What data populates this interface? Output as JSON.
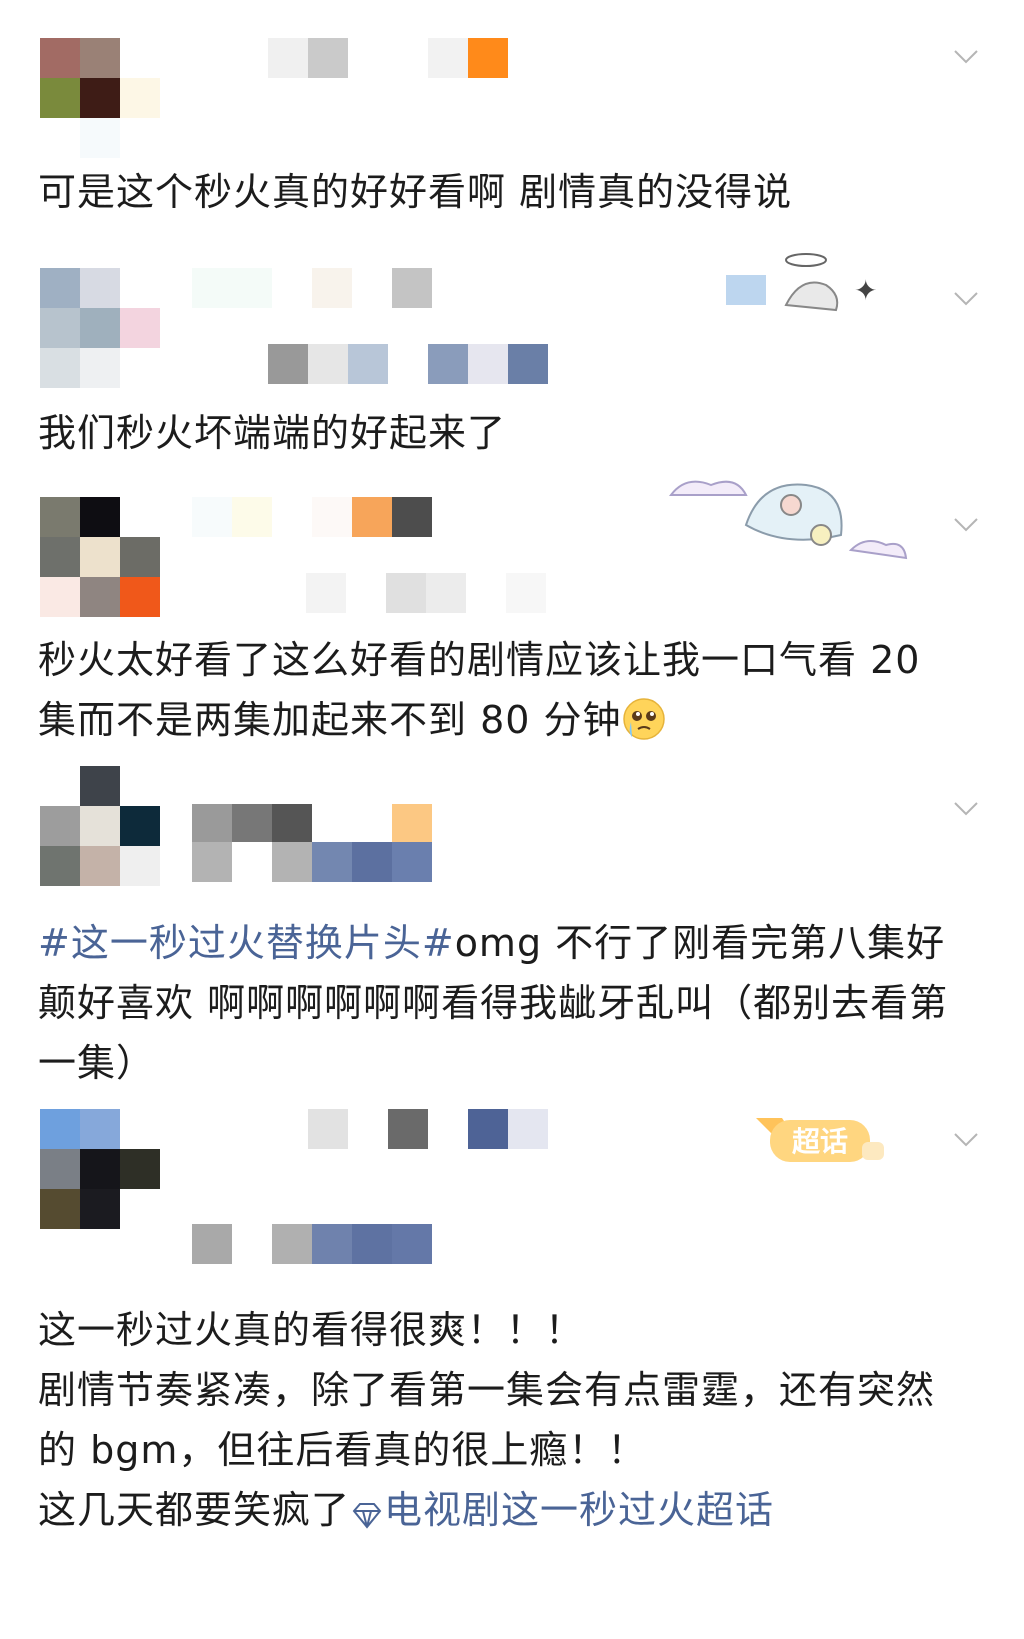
{
  "posts": [
    {
      "id": 1,
      "avatar_colors": [
        "#a26b64",
        "#9a8176",
        "#ffffff",
        "#7a8a3c",
        "#3e1c16",
        "#fdf7e6",
        "#ffffff",
        "#f6fafc",
        "#ffffff"
      ],
      "name_mosaic_row1": [
        "#f0f0f0",
        "#cacaca",
        "#ffffff",
        "#ffffff",
        "#f2f2f2",
        "#ff8a1a"
      ],
      "text": "可是这个秒火真的好好看啊 剧情真的没得说"
    },
    {
      "id": 2,
      "avatar_colors": [
        "#9fb0c3",
        "#d7dae3",
        "#ffffff",
        "#b7c3cd",
        "#9fb0bd",
        "#f3d4df",
        "#d9dfe3",
        "#eef0f2",
        "#ffffff"
      ],
      "name_mosaic_row1": [
        "#f4fbf8",
        "#f4fbf8",
        "#ffffff",
        "#f8f3ec",
        "#ffffff",
        "#c4c4c4"
      ],
      "name_mosaic_row2": [
        "#999999",
        "#e6e6e6",
        "#b8c6d8",
        "#ffffff",
        "#8a9cbb",
        "#e6e6ef",
        "#6a7fa7"
      ],
      "text": "我们秒火坏端端的好起来了"
    },
    {
      "id": 3,
      "avatar_colors": [
        "#7a7a6e",
        "#0e0d12",
        "#ffffff",
        "#6e706b",
        "#ede1cc",
        "#6c6c66",
        "#fae9e4",
        "#8f8581",
        "#f0581a"
      ],
      "name_mosaic_row1": [
        "#f7fbfc",
        "#fdfbe9",
        "#ffffff",
        "#fdf9f7",
        "#f7a55a",
        "#4d4d4d"
      ],
      "name_mosaic_row2": [
        "#f3f3f3",
        "#ffffff",
        "#e0e0e0",
        "#ececec",
        "#ffffff",
        "#f7f7f7"
      ],
      "text": "秒火太好看了这么好看的剧情应该让我一口气看 20 集而不是两集加起来不到 80 分钟",
      "emoji": "crying-face-emoji"
    },
    {
      "id": 4,
      "avatar_colors": [
        "#ffffff",
        "#3e434a",
        "#ffffff",
        "#9d9d9d",
        "#e5e1d9",
        "#0d2a3a",
        "#6f746f",
        "#c4b2a8",
        "#efefef"
      ],
      "name_mosaic_row1": [
        "#9a9a9a",
        "#777777",
        "#555555",
        "#ffffff",
        "#ffffff",
        "#fcc883"
      ],
      "name_mosaic_row2": [
        "#b3b3b3",
        "#ffffff",
        "#b3b3b3",
        "#7387b0",
        "#5c70a0",
        "#6a7fae"
      ],
      "topic": "#这一秒过火替换片头#",
      "text": "omg 不行了刚看完第八集好颠好喜欢 啊啊啊啊啊啊看得我龇牙乱叫（都别去看第一集）"
    },
    {
      "id": 5,
      "avatar_colors": [
        "#6ea0de",
        "#86a8da",
        "#ffffff",
        "#7a7f86",
        "#15151a",
        "#2e2f26",
        "#554b30",
        "#1b1b20",
        "#ffffff"
      ],
      "name_mosaic_row1": [
        "#ffffff",
        "#e2e2e2",
        "#ffffff",
        "#6a6a6a",
        "#ffffff",
        "#4e6396",
        "#e4e6f0"
      ],
      "name_mosaic_row2": [
        "#a9a9a9",
        "#ffffff",
        "#b0b0b0",
        "#6f82ad",
        "#5e72a2",
        "#6478a8"
      ],
      "badge_label": "超话",
      "line1": "这一秒过火真的看得很爽！！！",
      "line2": "剧情节奏紧凑，除了看第一集会有点雷霆，还有突然的 bgm，但往后看真的很上瘾！！",
      "line3": "这几天都要笑疯了",
      "supertopic_icon": "diamond-icon",
      "supertopic_link": "电视剧这一秒过火超话"
    }
  ],
  "colors": {
    "link": "#4a6496",
    "text": "#1c1c1c",
    "chevron": "#b5b5b5"
  }
}
